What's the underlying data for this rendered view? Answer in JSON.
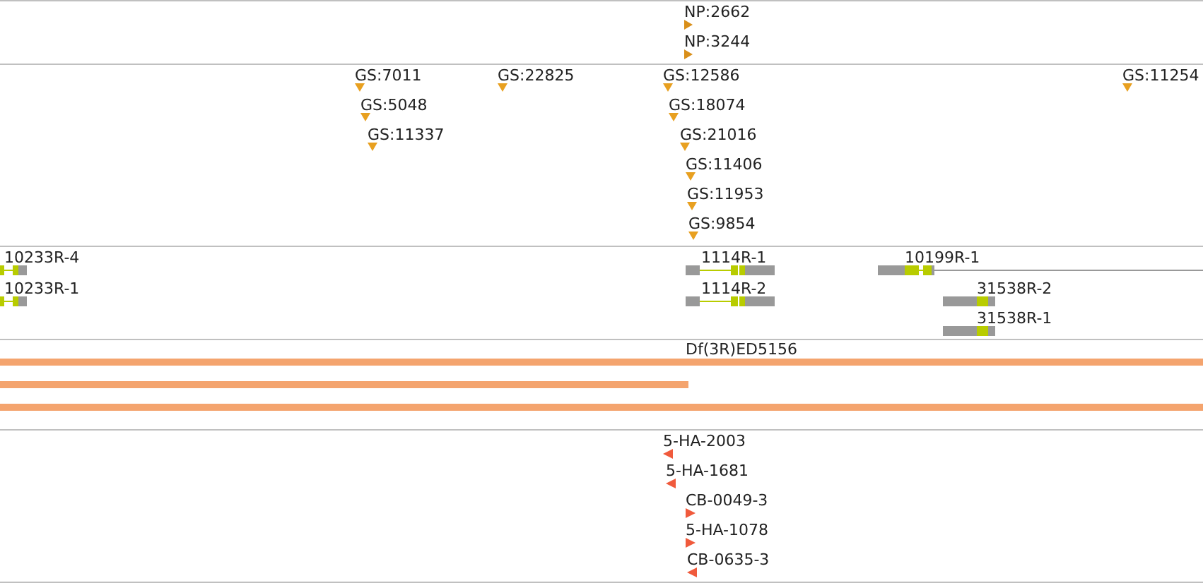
{
  "tracks": [
    {
      "kind": "np-insertions",
      "features": [
        {
          "label": "NP:2662"
        },
        {
          "label": "NP:3244"
        }
      ]
    },
    {
      "kind": "gs-insertions",
      "features": [
        {
          "label": "GS:7011"
        },
        {
          "label": "GS:5048"
        },
        {
          "label": "GS:11337"
        },
        {
          "label": "GS:22825"
        },
        {
          "label": "GS:12586"
        },
        {
          "label": "GS:18074"
        },
        {
          "label": "GS:21016"
        },
        {
          "label": "GS:11406"
        },
        {
          "label": "GS:11953"
        },
        {
          "label": "GS:9854"
        },
        {
          "label": "GS:11254"
        }
      ]
    },
    {
      "kind": "transcripts",
      "features": [
        {
          "label": "10233R-4"
        },
        {
          "label": "10233R-1"
        },
        {
          "label": "1114R-1"
        },
        {
          "label": "1114R-2"
        },
        {
          "label": "10199R-1"
        },
        {
          "label": "31538R-2"
        },
        {
          "label": "31538R-1"
        }
      ]
    },
    {
      "kind": "deficiencies",
      "features": [
        {
          "label": "Df(3R)ED5156"
        }
      ]
    },
    {
      "kind": "oligos",
      "features": [
        {
          "label": "5-HA-2003",
          "reverse": true
        },
        {
          "label": "5-HA-1681",
          "reverse": true
        },
        {
          "label": "CB-0049-3",
          "reverse": false
        },
        {
          "label": "5-HA-1078",
          "reverse": false
        },
        {
          "label": "CB-0635-3",
          "reverse": true
        }
      ]
    }
  ]
}
